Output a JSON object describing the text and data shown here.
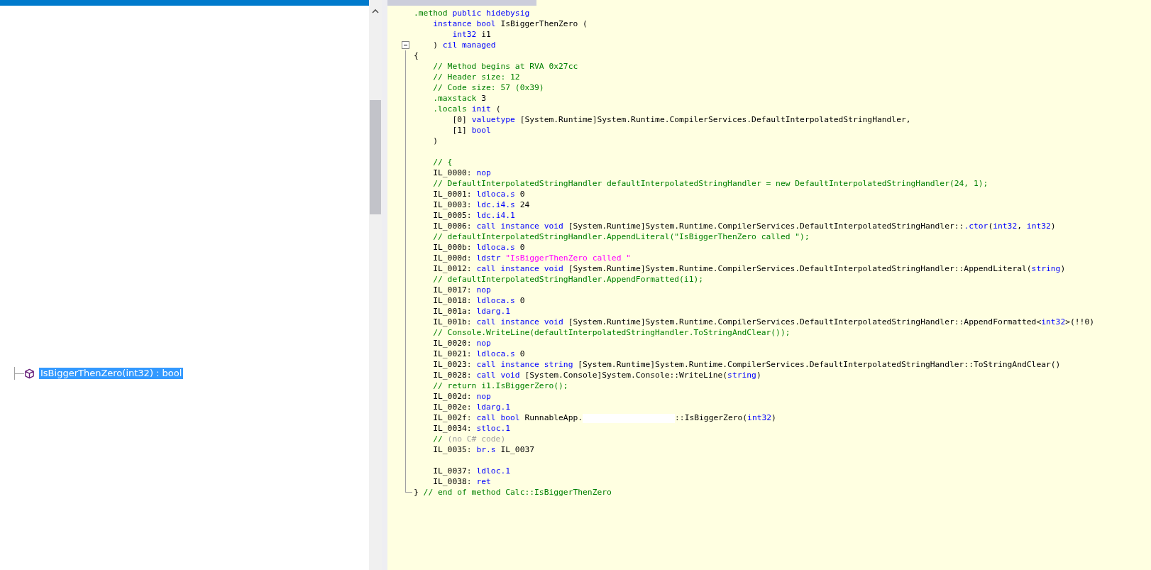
{
  "tree": {
    "items": [
      {
        "label": "IsBiggerThenZero(int32) : bool",
        "selected": true
      }
    ]
  },
  "code": {
    "fold": {
      "expanded": true
    },
    "lines": [
      {
        "kind": "code",
        "tokens": [
          {
            "kind": "directive",
            "text": ".method"
          },
          {
            "kind": "keyword",
            "text": " public hidebysig"
          }
        ]
      },
      {
        "kind": "code",
        "tokens": [
          {
            "kind": "keyword",
            "text": "    instance bool"
          },
          {
            "kind": "plain",
            "text": " IsBiggerThenZero ("
          }
        ]
      },
      {
        "kind": "code",
        "tokens": [
          {
            "kind": "keyword",
            "text": "        int32"
          },
          {
            "kind": "plain",
            "text": " i1"
          }
        ]
      },
      {
        "kind": "code",
        "tokens": [
          {
            "kind": "plain",
            "text": "    ) "
          },
          {
            "kind": "keyword",
            "text": "cil managed"
          }
        ]
      },
      {
        "kind": "code",
        "tokens": [
          {
            "kind": "plain",
            "text": "{"
          }
        ]
      },
      {
        "kind": "code",
        "tokens": [
          {
            "kind": "comment",
            "text": "    // Method begins at RVA 0x27cc"
          }
        ]
      },
      {
        "kind": "code",
        "tokens": [
          {
            "kind": "comment",
            "text": "    // Header size: 12"
          }
        ]
      },
      {
        "kind": "code",
        "tokens": [
          {
            "kind": "comment",
            "text": "    // Code size: 57 (0x39)"
          }
        ]
      },
      {
        "kind": "code",
        "tokens": [
          {
            "kind": "directive",
            "text": "    .maxstack"
          },
          {
            "kind": "plain",
            "text": " 3"
          }
        ]
      },
      {
        "kind": "code",
        "tokens": [
          {
            "kind": "directive",
            "text": "    .locals"
          },
          {
            "kind": "keyword",
            "text": " init"
          },
          {
            "kind": "plain",
            "text": " ("
          }
        ]
      },
      {
        "kind": "code",
        "tokens": [
          {
            "kind": "plain",
            "text": "        [0] "
          },
          {
            "kind": "keyword",
            "text": "valuetype"
          },
          {
            "kind": "plain",
            "text": " [System.Runtime]System.Runtime.CompilerServices.DefaultInterpolatedStringHandler,"
          }
        ]
      },
      {
        "kind": "code",
        "tokens": [
          {
            "kind": "plain",
            "text": "        [1] "
          },
          {
            "kind": "keyword",
            "text": "bool"
          }
        ]
      },
      {
        "kind": "code",
        "tokens": [
          {
            "kind": "plain",
            "text": "    )"
          }
        ]
      },
      {
        "kind": "blank"
      },
      {
        "kind": "code",
        "tokens": [
          {
            "kind": "comment",
            "text": "    // {"
          }
        ]
      },
      {
        "kind": "code",
        "tokens": [
          {
            "kind": "plain",
            "text": "    IL_0000: "
          },
          {
            "kind": "keyword",
            "text": "nop"
          }
        ]
      },
      {
        "kind": "code",
        "tokens": [
          {
            "kind": "comment",
            "text": "    // DefaultInterpolatedStringHandler defaultInterpolatedStringHandler = new DefaultInterpolatedStringHandler(24, 1);"
          }
        ]
      },
      {
        "kind": "code",
        "tokens": [
          {
            "kind": "plain",
            "text": "    IL_0001: "
          },
          {
            "kind": "keyword",
            "text": "ldloca.s"
          },
          {
            "kind": "plain",
            "text": " 0"
          }
        ]
      },
      {
        "kind": "code",
        "tokens": [
          {
            "kind": "plain",
            "text": "    IL_0003: "
          },
          {
            "kind": "keyword",
            "text": "ldc.i4.s"
          },
          {
            "kind": "plain",
            "text": " 24"
          }
        ]
      },
      {
        "kind": "code",
        "tokens": [
          {
            "kind": "plain",
            "text": "    IL_0005: "
          },
          {
            "kind": "keyword",
            "text": "ldc.i4.1"
          }
        ]
      },
      {
        "kind": "code",
        "tokens": [
          {
            "kind": "plain",
            "text": "    IL_0006: "
          },
          {
            "kind": "keyword",
            "text": "call instance void"
          },
          {
            "kind": "plain",
            "text": " [System.Runtime]System.Runtime.CompilerServices.DefaultInterpolatedStringHandler::"
          },
          {
            "kind": "keyword",
            "text": ".ctor"
          },
          {
            "kind": "plain",
            "text": "("
          },
          {
            "kind": "keyword",
            "text": "int32"
          },
          {
            "kind": "plain",
            "text": ", "
          },
          {
            "kind": "keyword",
            "text": "int32"
          },
          {
            "kind": "plain",
            "text": ")"
          }
        ]
      },
      {
        "kind": "code",
        "tokens": [
          {
            "kind": "comment",
            "text": "    // defaultInterpolatedStringHandler.AppendLiteral(\"IsBiggerThenZero called \");"
          }
        ]
      },
      {
        "kind": "code",
        "tokens": [
          {
            "kind": "plain",
            "text": "    IL_000b: "
          },
          {
            "kind": "keyword",
            "text": "ldloca.s"
          },
          {
            "kind": "plain",
            "text": " 0"
          }
        ]
      },
      {
        "kind": "code",
        "tokens": [
          {
            "kind": "plain",
            "text": "    IL_000d: "
          },
          {
            "kind": "keyword",
            "text": "ldstr"
          },
          {
            "kind": "string",
            "text": " \"IsBiggerThenZero called \""
          }
        ]
      },
      {
        "kind": "code",
        "tokens": [
          {
            "kind": "plain",
            "text": "    IL_0012: "
          },
          {
            "kind": "keyword",
            "text": "call instance void"
          },
          {
            "kind": "plain",
            "text": " [System.Runtime]System.Runtime.CompilerServices.DefaultInterpolatedStringHandler::AppendLiteral("
          },
          {
            "kind": "keyword",
            "text": "string"
          },
          {
            "kind": "plain",
            "text": ")"
          }
        ]
      },
      {
        "kind": "code",
        "tokens": [
          {
            "kind": "comment",
            "text": "    // defaultInterpolatedStringHandler.AppendFormatted(i1);"
          }
        ]
      },
      {
        "kind": "code",
        "tokens": [
          {
            "kind": "plain",
            "text": "    IL_0017: "
          },
          {
            "kind": "keyword",
            "text": "nop"
          }
        ]
      },
      {
        "kind": "code",
        "tokens": [
          {
            "kind": "plain",
            "text": "    IL_0018: "
          },
          {
            "kind": "keyword",
            "text": "ldloca.s"
          },
          {
            "kind": "plain",
            "text": " 0"
          }
        ]
      },
      {
        "kind": "code",
        "tokens": [
          {
            "kind": "plain",
            "text": "    IL_001a: "
          },
          {
            "kind": "keyword",
            "text": "ldarg.1"
          }
        ]
      },
      {
        "kind": "code",
        "tokens": [
          {
            "kind": "plain",
            "text": "    IL_001b: "
          },
          {
            "kind": "keyword",
            "text": "call instance void"
          },
          {
            "kind": "plain",
            "text": " [System.Runtime]System.Runtime.CompilerServices.DefaultInterpolatedStringHandler::AppendFormatted<"
          },
          {
            "kind": "keyword",
            "text": "int32"
          },
          {
            "kind": "plain",
            "text": ">(!!0)"
          }
        ]
      },
      {
        "kind": "code",
        "tokens": [
          {
            "kind": "comment",
            "text": "    // Console.WriteLine(defaultInterpolatedStringHandler.ToStringAndClear());"
          }
        ]
      },
      {
        "kind": "code",
        "tokens": [
          {
            "kind": "plain",
            "text": "    IL_0020: "
          },
          {
            "kind": "keyword",
            "text": "nop"
          }
        ]
      },
      {
        "kind": "code",
        "tokens": [
          {
            "kind": "plain",
            "text": "    IL_0021: "
          },
          {
            "kind": "keyword",
            "text": "ldloca.s"
          },
          {
            "kind": "plain",
            "text": " 0"
          }
        ]
      },
      {
        "kind": "code",
        "tokens": [
          {
            "kind": "plain",
            "text": "    IL_0023: "
          },
          {
            "kind": "keyword",
            "text": "call instance string"
          },
          {
            "kind": "plain",
            "text": " [System.Runtime]System.Runtime.CompilerServices.DefaultInterpolatedStringHandler::ToStringAndClear()"
          }
        ]
      },
      {
        "kind": "code",
        "tokens": [
          {
            "kind": "plain",
            "text": "    IL_0028: "
          },
          {
            "kind": "keyword",
            "text": "call void"
          },
          {
            "kind": "plain",
            "text": " [System.Console]System.Console::WriteLine("
          },
          {
            "kind": "keyword",
            "text": "string"
          },
          {
            "kind": "plain",
            "text": ")"
          }
        ]
      },
      {
        "kind": "code",
        "tokens": [
          {
            "kind": "comment",
            "text": "    // return i1.IsBiggerZero();"
          }
        ]
      },
      {
        "kind": "code",
        "tokens": [
          {
            "kind": "plain",
            "text": "    IL_002d: "
          },
          {
            "kind": "keyword",
            "text": "nop"
          }
        ]
      },
      {
        "kind": "code",
        "tokens": [
          {
            "kind": "plain",
            "text": "    IL_002e: "
          },
          {
            "kind": "keyword",
            "text": "ldarg.1"
          }
        ]
      },
      {
        "kind": "code",
        "tokens": [
          {
            "kind": "plain",
            "text": "    IL_002f: "
          },
          {
            "kind": "keyword",
            "text": "call bool"
          },
          {
            "kind": "plain",
            "text": " RunnableApp."
          },
          {
            "kind": "redacted"
          },
          {
            "kind": "plain",
            "text": "::IsBiggerZero("
          },
          {
            "kind": "keyword",
            "text": "int32"
          },
          {
            "kind": "plain",
            "text": ")"
          }
        ]
      },
      {
        "kind": "code",
        "tokens": [
          {
            "kind": "plain",
            "text": "    IL_0034: "
          },
          {
            "kind": "keyword",
            "text": "stloc.1"
          }
        ]
      },
      {
        "kind": "code",
        "tokens": [
          {
            "kind": "comment",
            "text": "    // "
          },
          {
            "kind": "note",
            "text": "(no C# code)"
          }
        ]
      },
      {
        "kind": "code",
        "tokens": [
          {
            "kind": "plain",
            "text": "    IL_0035: "
          },
          {
            "kind": "keyword",
            "text": "br.s"
          },
          {
            "kind": "plain",
            "text": " IL_0037"
          }
        ]
      },
      {
        "kind": "blank"
      },
      {
        "kind": "code",
        "tokens": [
          {
            "kind": "plain",
            "text": "    IL_0037: "
          },
          {
            "kind": "keyword",
            "text": "ldloc.1"
          }
        ]
      },
      {
        "kind": "code",
        "tokens": [
          {
            "kind": "plain",
            "text": "    IL_0038: "
          },
          {
            "kind": "keyword",
            "text": "ret"
          }
        ]
      },
      {
        "kind": "code",
        "tokens": [
          {
            "kind": "plain",
            "text": "} "
          },
          {
            "kind": "comment",
            "text": "// end of method Calc::IsBiggerThenZero"
          }
        ]
      }
    ]
  }
}
